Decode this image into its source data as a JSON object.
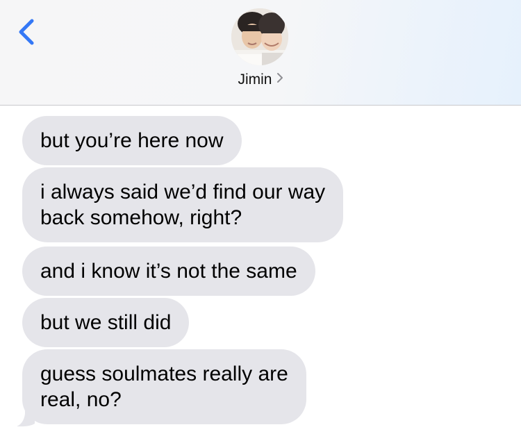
{
  "header": {
    "contact_name": "Jimin",
    "back_icon": "chevron-left-icon",
    "name_chevron_icon": "chevron-right-icon",
    "accent_color": "#3478f6"
  },
  "messages": [
    {
      "lines": [
        "but you’re here now"
      ]
    },
    {
      "lines": [
        "i always said we’d find our way",
        "back somehow, right?"
      ]
    },
    {
      "lines": [
        "and i know it’s not the same"
      ]
    },
    {
      "lines": [
        "but we still did"
      ]
    },
    {
      "lines": [
        "guess soulmates really are",
        "real, no?"
      ]
    }
  ],
  "colors": {
    "incoming_bubble": "#e5e5ea",
    "header_background": "#f6f6f7"
  }
}
